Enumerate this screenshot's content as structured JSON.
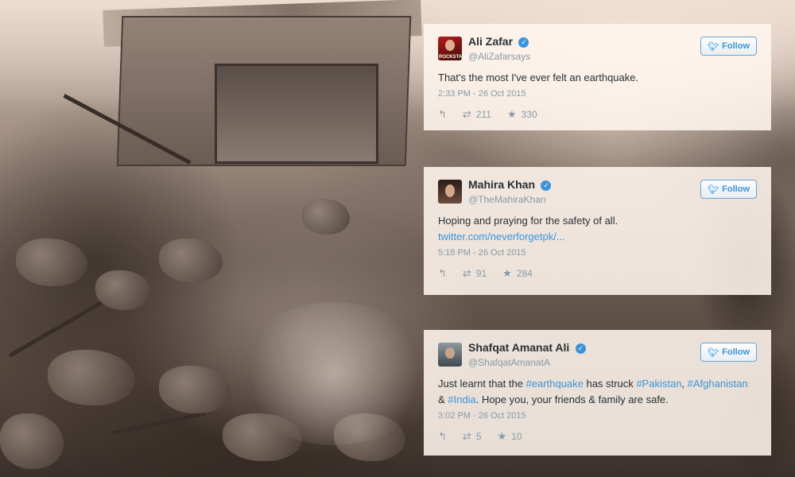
{
  "tweets": [
    {
      "name": "Ali Zafar",
      "handle": "@AliZafarsays",
      "follow_label": "Follow",
      "text_parts": [
        {
          "t": "That's the most I've ever felt an earthquake.",
          "kind": "plain"
        }
      ],
      "time": "2:33 PM - 26 Oct 2015",
      "retweets": "211",
      "favorites": "330",
      "avatar_text": "ROCKSTAR"
    },
    {
      "name": "Mahira Khan",
      "handle": "@TheMahiraKhan",
      "follow_label": "Follow",
      "text_parts": [
        {
          "t": "Hoping and praying for the safety of all.",
          "kind": "plain"
        }
      ],
      "link": "twitter.com/neverforgetpk/...",
      "time": "5:18 PM - 26 Oct 2015",
      "retweets": "91",
      "favorites": "284"
    },
    {
      "name": "Shafqat Amanat Ali",
      "handle": "@ShafqatAmanatA",
      "follow_label": "Follow",
      "text_parts": [
        {
          "t": "Just learnt that the ",
          "kind": "plain"
        },
        {
          "t": "#earthquake",
          "kind": "hash"
        },
        {
          "t": " has struck ",
          "kind": "plain"
        },
        {
          "t": "#Pakistan",
          "kind": "hash"
        },
        {
          "t": ", ",
          "kind": "plain"
        },
        {
          "t": "#Afghanistan",
          "kind": "hash"
        },
        {
          "t": " & ",
          "kind": "plain"
        },
        {
          "t": "#India",
          "kind": "hash"
        },
        {
          "t": ". Hope you, your friends & family are safe.",
          "kind": "plain"
        }
      ],
      "time": "3:02 PM - 26 Oct 2015",
      "retweets": "5",
      "favorites": "10"
    }
  ],
  "icons": {
    "verified": "verified-check-icon",
    "bird": "twitter-bird-icon",
    "reply": "reply-icon",
    "retweet": "retweet-icon",
    "favorite": "star-icon"
  },
  "colors": {
    "twitter_blue": "#3b94d9",
    "muted": "#8899a6",
    "card_bg": "#fff6ee"
  }
}
